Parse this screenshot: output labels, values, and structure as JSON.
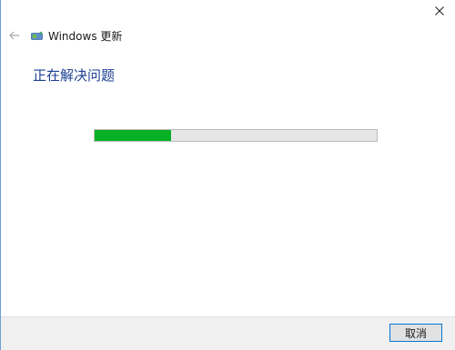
{
  "window": {
    "title": "Windows 更新",
    "heading": "正在解决问题",
    "progress_fraction": 0.27
  },
  "footer": {
    "cancel_label": "取消"
  },
  "icons": {
    "back": "back-arrow-icon",
    "close": "close-icon",
    "title": "windows-update-icon"
  },
  "colors": {
    "heading": "#1c3f94",
    "progress_fill": "#06b025",
    "progress_track": "#e6e6e6",
    "button_border": "#0078d7"
  }
}
